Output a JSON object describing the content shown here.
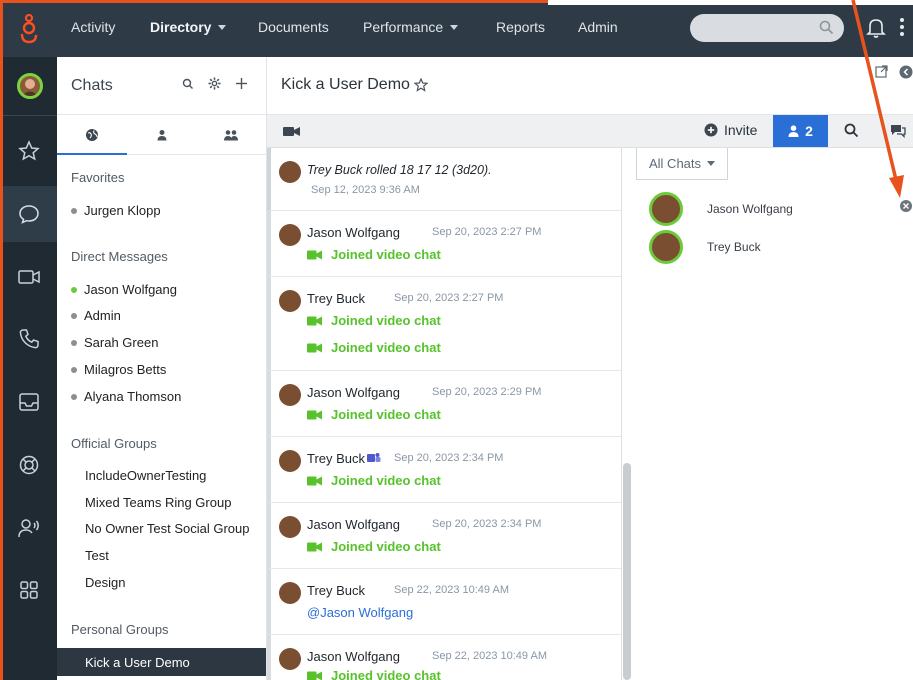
{
  "nav": {
    "items": [
      "Activity",
      "Directory",
      "Documents",
      "Performance",
      "Reports",
      "Admin"
    ]
  },
  "rail": {
    "icons": [
      "star-icon",
      "chat-bubble-icon",
      "video-icon",
      "phone-icon",
      "inbox-icon",
      "lifebuoy-icon",
      "contact-icon",
      "apps-icon"
    ]
  },
  "chats": {
    "title": "Chats",
    "favorites_title": "Favorites",
    "favorites": [
      "Jurgen Klopp"
    ],
    "dm_title": "Direct Messages",
    "direct_messages": [
      {
        "name": "Jason Wolfgang",
        "status": "online"
      },
      {
        "name": "Admin",
        "status": "offline"
      },
      {
        "name": "Sarah Green",
        "status": "offline"
      },
      {
        "name": "Milagros Betts",
        "status": "offline"
      },
      {
        "name": "Alyana Thomson",
        "status": "offline"
      }
    ],
    "official_title": "Official Groups",
    "official_groups": [
      "IncludeOwnerTesting",
      "Mixed Teams Ring Group",
      "No Owner Test Social Group",
      "Test",
      "Design"
    ],
    "personal_title": "Personal Groups",
    "personal_groups": [
      "Kick a User Demo"
    ]
  },
  "room": {
    "title": "Kick a User Demo",
    "invite_label": "Invite",
    "participant_count": "2"
  },
  "messages": [
    {
      "type": "system",
      "text": "Trey Buck rolled 18 17 12 (3d20).",
      "time": "Sep 12, 2023 9:36 AM"
    },
    {
      "name": "Jason Wolfgang",
      "time": "Sep 20, 2023 2:27 PM",
      "lines": [
        "Joined video chat"
      ]
    },
    {
      "name": "Trey Buck",
      "time": "Sep 20, 2023 2:27 PM",
      "lines": [
        "Joined video chat",
        "Joined video chat"
      ]
    },
    {
      "name": "Jason Wolfgang",
      "time": "Sep 20, 2023 2:29 PM",
      "lines": [
        "Joined video chat"
      ]
    },
    {
      "name": "Trey Buck",
      "time": "Sep 20, 2023 2:34 PM",
      "lines": [
        "Joined video chat"
      ]
    },
    {
      "name": "Jason Wolfgang",
      "time": "Sep 20, 2023 2:34 PM",
      "lines": [
        "Joined video chat"
      ]
    },
    {
      "name": "Trey Buck",
      "time": "Sep 22, 2023 10:49 AM",
      "mention": "@Jason Wolfgang"
    },
    {
      "name": "Jason Wolfgang",
      "time": "Sep 22, 2023 10:49 AM",
      "lines": [
        "Joined video chat"
      ]
    }
  ],
  "participants": {
    "filter_label": "All Chats",
    "list": [
      "Jason Wolfgang",
      "Trey Buck"
    ]
  },
  "colors": {
    "nav_bg": "#2e3a45",
    "rail_bg": "#1f2a33",
    "accent_blue": "#2a6fd6",
    "video_green": "#57c22b",
    "annotation_orange": "#e8531d"
  }
}
